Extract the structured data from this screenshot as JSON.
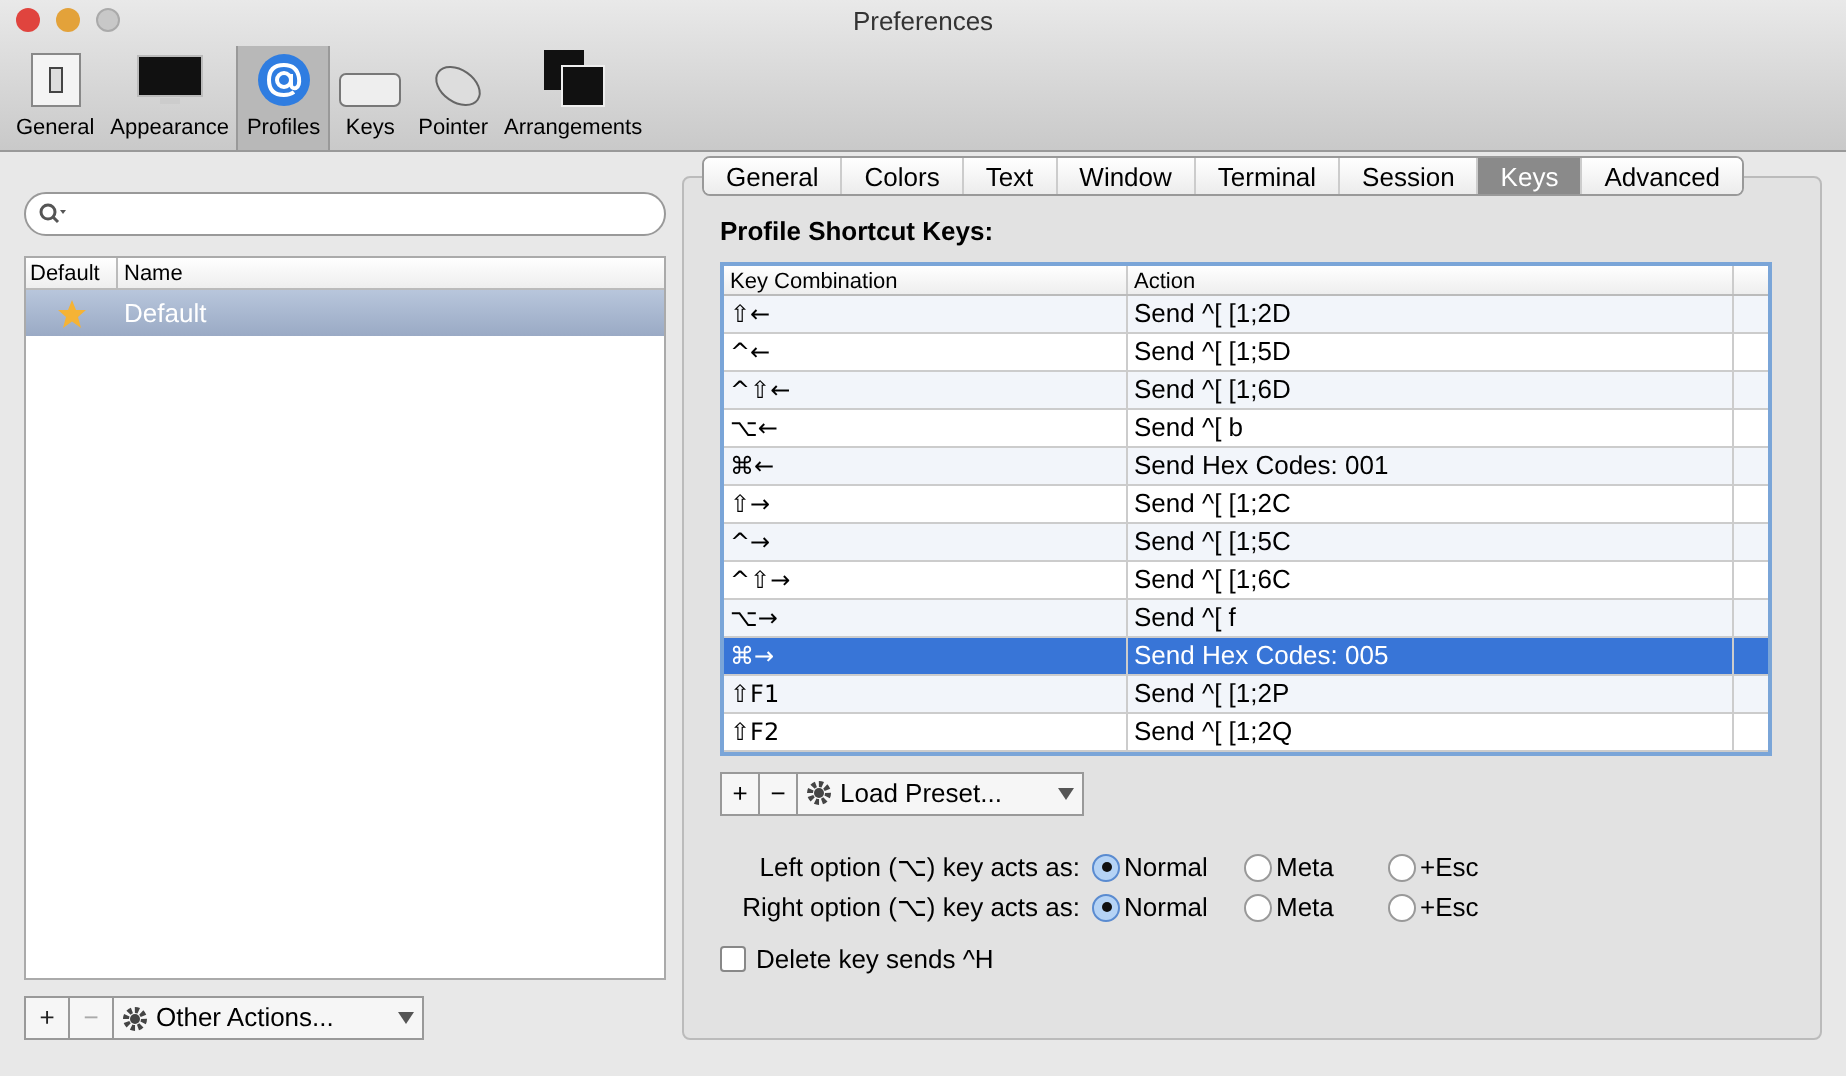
{
  "window": {
    "title": "Preferences"
  },
  "toolbar": [
    {
      "label": "General",
      "kind": "switch",
      "selected": false
    },
    {
      "label": "Appearance",
      "kind": "monitor",
      "selected": false
    },
    {
      "label": "Profiles",
      "kind": "at",
      "selected": true
    },
    {
      "label": "Keys",
      "kind": "keyboard",
      "selected": false
    },
    {
      "label": "Pointer",
      "kind": "mouse",
      "selected": false
    },
    {
      "label": "Arrangements",
      "kind": "windows",
      "selected": false
    }
  ],
  "profiles": {
    "columns": [
      "Default",
      "Name"
    ],
    "rows": [
      {
        "name": "Default",
        "default": true,
        "selected": true
      }
    ],
    "buttons": [
      {
        "label": "+",
        "disabled": false
      },
      {
        "label": "−",
        "disabled": true
      }
    ],
    "actions": "Other Actions..."
  },
  "tabs": [
    {
      "label": "General",
      "selected": false
    },
    {
      "label": "Colors",
      "selected": false
    },
    {
      "label": "Text",
      "selected": false
    },
    {
      "label": "Window",
      "selected": false
    },
    {
      "label": "Terminal",
      "selected": false
    },
    {
      "label": "Session",
      "selected": false
    },
    {
      "label": "Keys",
      "selected": true
    },
    {
      "label": "Advanced",
      "selected": false
    }
  ],
  "shortcuts": {
    "title": "Profile Shortcut Keys:",
    "columns": [
      "Key Combination",
      "Action"
    ],
    "rows": [
      {
        "key": "⇧←",
        "action": "Send ^[ [1;2D",
        "selected": false
      },
      {
        "key": "^←",
        "action": "Send ^[ [1;5D",
        "selected": false
      },
      {
        "key": "^⇧←",
        "action": "Send ^[ [1;6D",
        "selected": false
      },
      {
        "key": "⌥←",
        "action": "Send ^[ b",
        "selected": false
      },
      {
        "key": "⌘←",
        "action": "Send Hex Codes: 001",
        "selected": false
      },
      {
        "key": "⇧→",
        "action": "Send ^[ [1;2C",
        "selected": false
      },
      {
        "key": "^→",
        "action": "Send ^[ [1;5C",
        "selected": false
      },
      {
        "key": "^⇧→",
        "action": "Send ^[ [1;6C",
        "selected": false
      },
      {
        "key": "⌥→",
        "action": "Send ^[ f",
        "selected": false
      },
      {
        "key": "⌘→",
        "action": "Send Hex Codes: 005",
        "selected": true
      },
      {
        "key": "⇧F1",
        "action": "Send ^[ [1;2P",
        "selected": false
      },
      {
        "key": "⇧F2",
        "action": "Send ^[ [1;2Q",
        "selected": false
      }
    ],
    "buttons": [
      "+",
      "−"
    ],
    "preset": "Load Preset..."
  },
  "options": [
    {
      "label": "Left option (⌥) key acts as:",
      "choices": [
        {
          "label": "Normal",
          "selected": true
        },
        {
          "label": "Meta",
          "selected": false
        },
        {
          "label": "+Esc",
          "selected": false
        }
      ]
    },
    {
      "label": "Right option (⌥) key acts as:",
      "choices": [
        {
          "label": "Normal",
          "selected": true
        },
        {
          "label": "Meta",
          "selected": false
        },
        {
          "label": "+Esc",
          "selected": false
        }
      ]
    }
  ],
  "delete_key": {
    "label": "Delete key sends ^H",
    "checked": false
  }
}
